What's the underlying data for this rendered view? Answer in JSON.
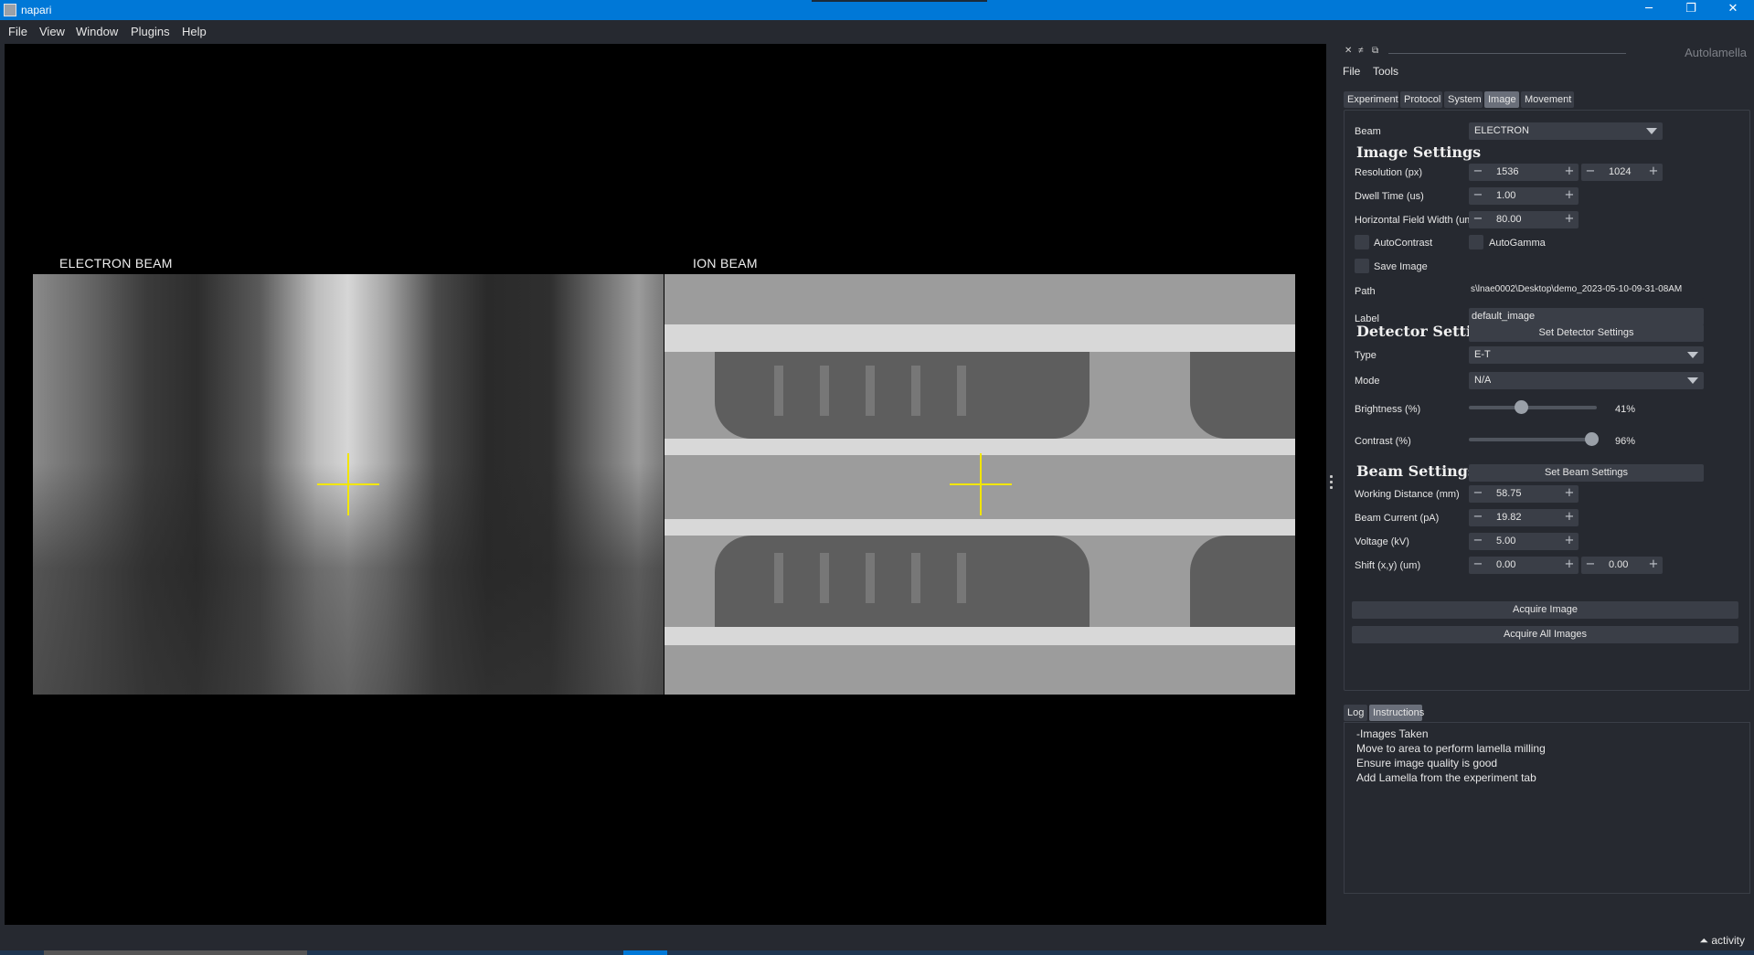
{
  "window": {
    "title": "napari",
    "minimize_glyph": "─",
    "maximize_glyph": "❐",
    "close_glyph": "✕"
  },
  "menubar": [
    "File",
    "View",
    "Window",
    "Plugins",
    "Help"
  ],
  "canvas": {
    "electron_label": "ELECTRON BEAM",
    "ion_label": "ION BEAM",
    "crosshair_color": "#f2e600"
  },
  "dock": {
    "title": "Autolamella",
    "controls": [
      "✕",
      "≠",
      "⧉"
    ],
    "menu": [
      "File",
      "Tools"
    ],
    "tabs": [
      "Experiment",
      "Protocol",
      "System",
      "Image",
      "Movement"
    ],
    "active_tab": "Image"
  },
  "image_settings": {
    "beam_label": "Beam",
    "beam_value": "ELECTRON",
    "section_title": "Image Settings",
    "resolution_label": "Resolution (px)",
    "resolution_x": "1536",
    "resolution_y": "1024",
    "dwell_label": "Dwell Time (us)",
    "dwell_value": "1.00",
    "hfw_label": "Horizontal Field Width (um)",
    "hfw_value": "80.00",
    "autocontrast_label": "AutoContrast",
    "autogamma_label": "AutoGamma",
    "save_label": "Save Image",
    "path_label": "Path",
    "path_value": "s\\lnae0002\\Desktop\\demo_2023-05-10-09-31-08AM",
    "label_label": "Label",
    "label_value": "default_image"
  },
  "detector_settings": {
    "section_title": "Detector Settings",
    "set_button": "Set Detector Settings",
    "type_label": "Type",
    "type_value": "E-T",
    "mode_label": "Mode",
    "mode_value": "N/A",
    "brightness_label": "Brightness (%)",
    "brightness_value": "41%",
    "brightness_level": 0.41,
    "contrast_label": "Contrast (%)",
    "contrast_value": "96%",
    "contrast_level": 0.96
  },
  "beam_settings": {
    "section_title": "Beam Settings",
    "set_button": "Set Beam Settings",
    "wd_label": "Working Distance (mm)",
    "wd_value": "58.75",
    "current_label": "Beam Current (pA)",
    "current_value": "19.82",
    "voltage_label": "Voltage (kV)",
    "voltage_value": "5.00",
    "shift_label": "Shift (x,y) (um)",
    "shift_x": "0.00",
    "shift_y": "0.00"
  },
  "actions": {
    "acquire": "Acquire Image",
    "acquire_all": "Acquire All Images"
  },
  "log_panel": {
    "tabs": [
      "Log",
      "Instructions"
    ],
    "active_tab": "Instructions",
    "lines": [
      "-Images Taken",
      "Move to area to perform lamella milling",
      "Ensure image quality is good",
      "Add Lamella from the experiment tab"
    ]
  },
  "status": {
    "activity": "activity",
    "activity_glyph": "⏶"
  }
}
